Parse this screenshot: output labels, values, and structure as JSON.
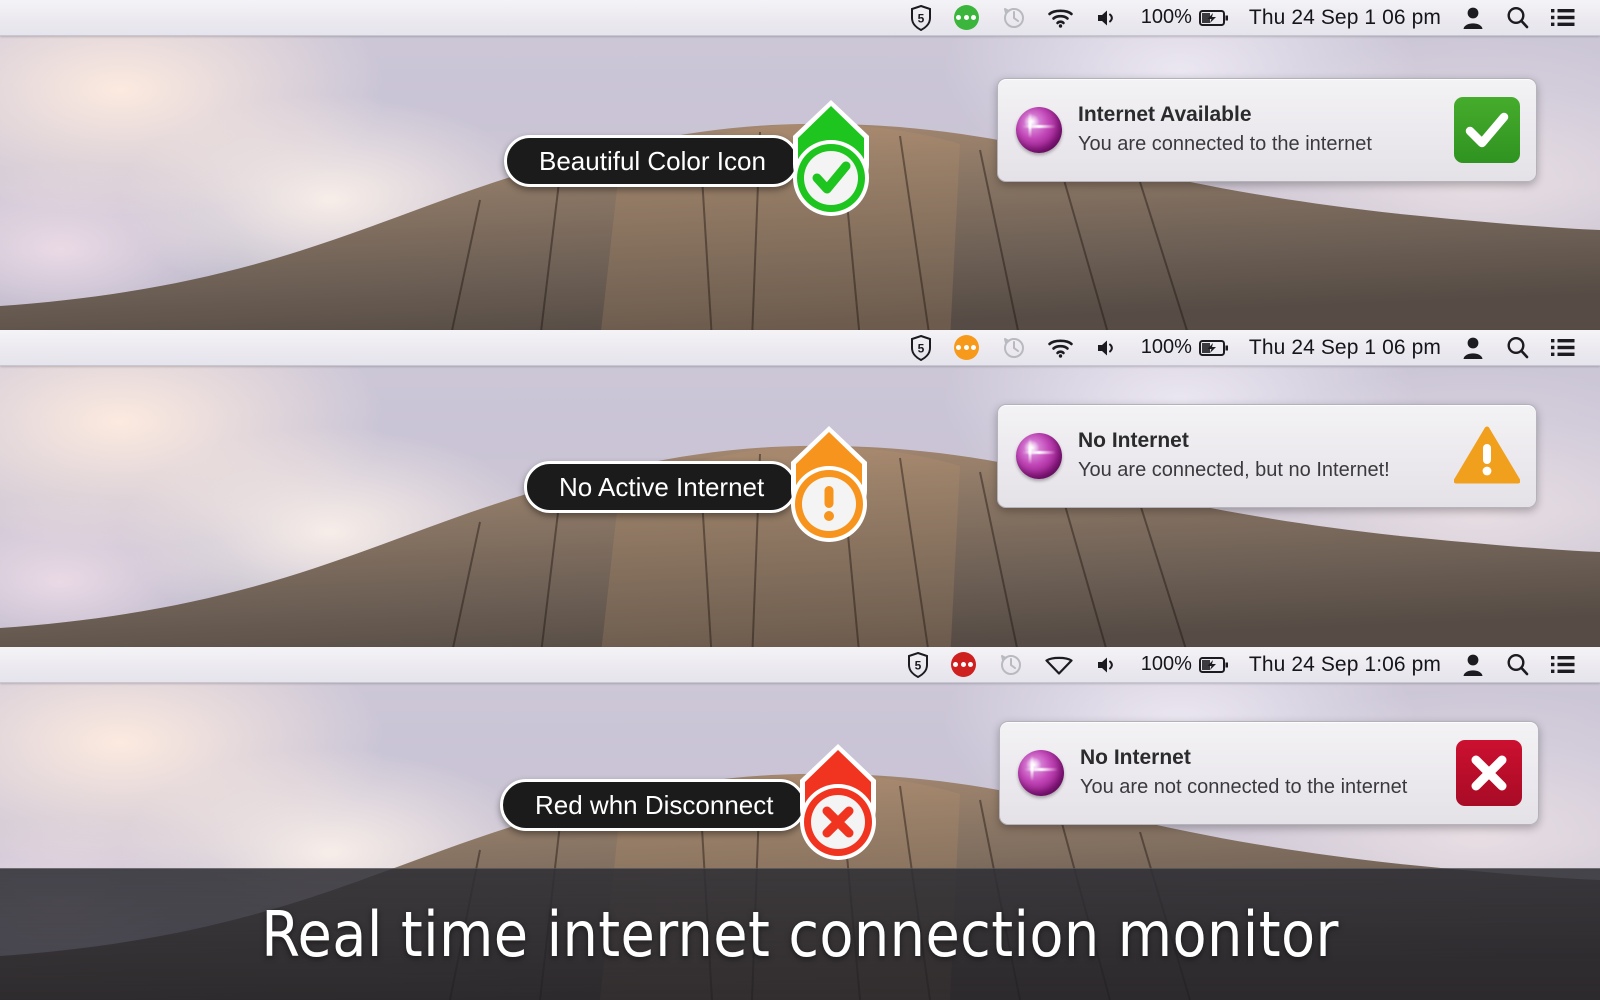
{
  "caption": {
    "text": "Real time internet connection monitor"
  },
  "colors": {
    "green": "#27c93f",
    "orange": "#f79a1b",
    "red": "#ef3324",
    "badge_green": "#3a9e24",
    "badge_orange": "#f0a01d",
    "badge_red": "#c01030",
    "pill_bg": "#1b1b1b",
    "menubar_bg": "#eceaf0"
  },
  "panels": [
    {
      "id": "panel-connected",
      "menubar": {
        "icons": [
          "shield-5-icon",
          "dots-status-icon",
          "time-machine-icon",
          "wifi-icon",
          "volume-icon"
        ],
        "app_icon_color": "green",
        "wifi_state": "connected",
        "battery_percent": "100%",
        "battery_icon": "battery-charging-icon",
        "clock": "Thu 24 Sep  1 06 pm",
        "right_icons": [
          "user-icon",
          "search-icon",
          "notification-center-icon"
        ]
      },
      "callout": {
        "label": "Beautiful Color Icon",
        "marker": "check-marker",
        "color": "green"
      },
      "notification": {
        "icon": "purple-globe-icon",
        "title": "Internet Available",
        "body": "You are connected to the internet",
        "badge": "check-badge",
        "badge_color": "green"
      }
    },
    {
      "id": "panel-no-active-internet",
      "menubar": {
        "icons": [
          "shield-5-icon",
          "dots-status-icon",
          "time-machine-icon",
          "wifi-icon",
          "volume-icon"
        ],
        "app_icon_color": "orange",
        "wifi_state": "connected",
        "battery_percent": "100%",
        "battery_icon": "battery-charging-icon",
        "clock": "Thu 24 Sep  1 06 pm",
        "right_icons": [
          "user-icon",
          "search-icon",
          "notification-center-icon"
        ]
      },
      "callout": {
        "label": "No Active Internet",
        "marker": "warning-marker",
        "color": "orange"
      },
      "notification": {
        "icon": "purple-globe-icon",
        "title": "No Internet",
        "body": "You are connected, but no Internet!",
        "badge": "warning-badge",
        "badge_color": "orange"
      }
    },
    {
      "id": "panel-disconnected",
      "menubar": {
        "icons": [
          "shield-5-icon",
          "dots-status-icon",
          "time-machine-icon",
          "wifi-off-icon",
          "volume-icon"
        ],
        "app_icon_color": "red",
        "wifi_state": "disconnected",
        "battery_percent": "100%",
        "battery_icon": "battery-charging-icon",
        "clock": "Thu 24 Sep  1:06 pm",
        "right_icons": [
          "user-icon",
          "search-icon",
          "notification-center-icon"
        ]
      },
      "callout": {
        "label": "Red whn Disconnect",
        "marker": "cross-marker",
        "color": "red"
      },
      "notification": {
        "icon": "purple-globe-icon",
        "title": "No Internet",
        "body": "You are not connected to the internet",
        "badge": "cross-badge",
        "badge_color": "red"
      }
    }
  ]
}
